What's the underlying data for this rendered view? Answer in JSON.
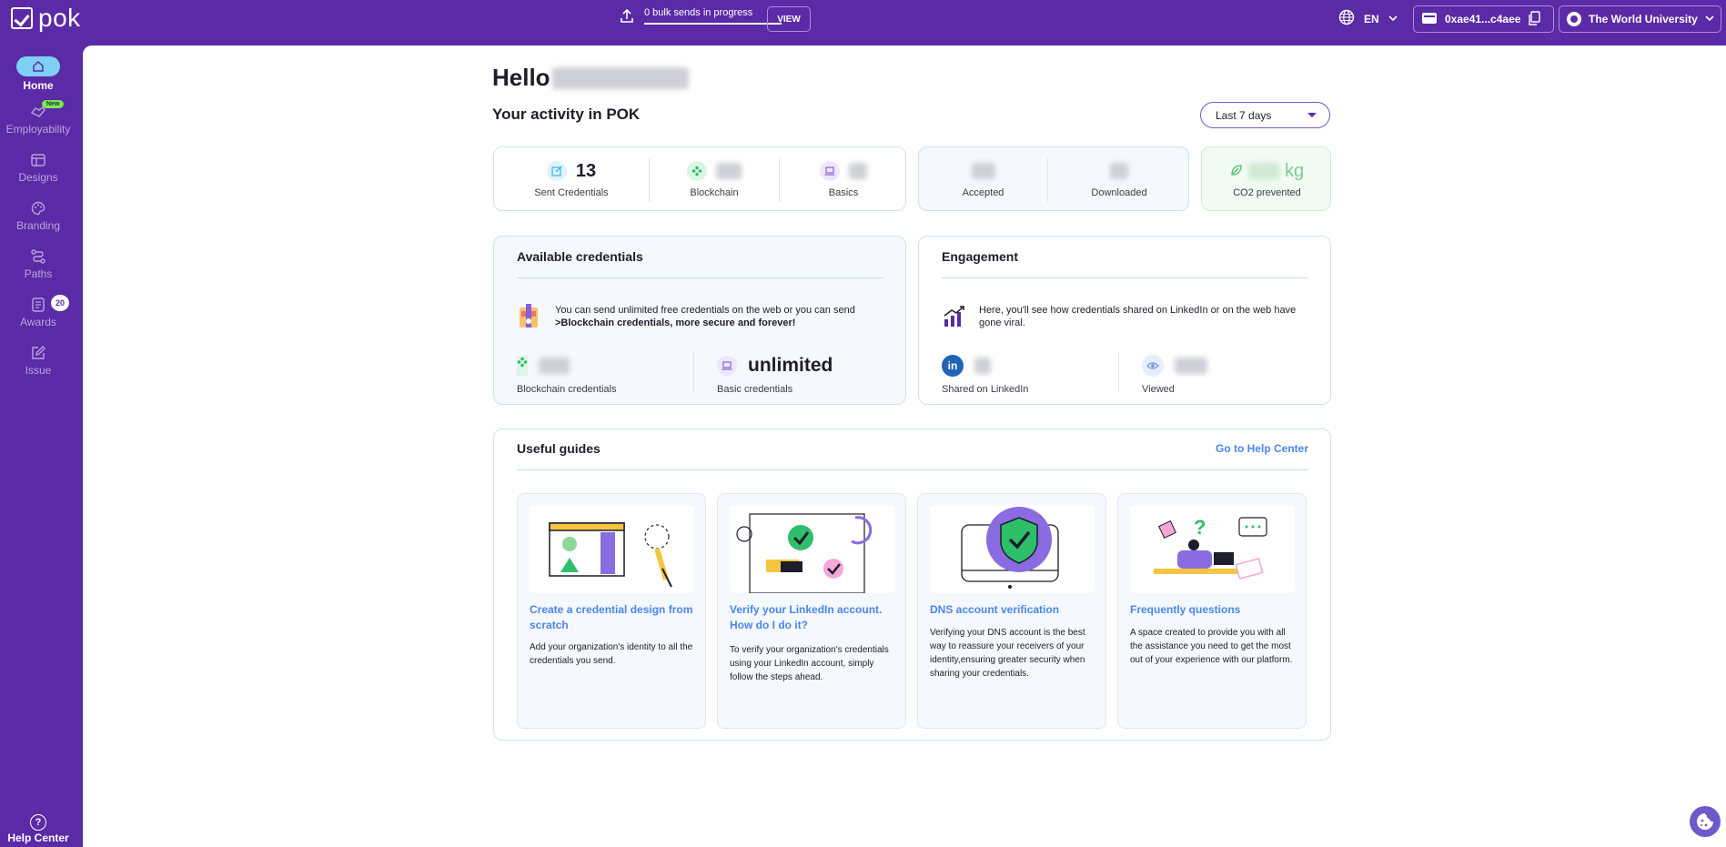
{
  "brand": {
    "name": "pok",
    "accent": "#5b2aa6"
  },
  "topbar": {
    "bulk_text": "0 bulk sends in progress",
    "view_label": "VIEW",
    "language": "EN",
    "wallet": "0xae41...c4aee",
    "organization": "The World University"
  },
  "sidebar": {
    "items": [
      {
        "label": "Home",
        "icon": "home-icon",
        "active": true
      },
      {
        "label": "Employability",
        "icon": "handshake-icon",
        "badge": "New"
      },
      {
        "label": "Designs",
        "icon": "layout-icon"
      },
      {
        "label": "Branding",
        "icon": "palette-icon"
      },
      {
        "label": "Paths",
        "icon": "route-icon"
      },
      {
        "label": "Awards",
        "icon": "document-icon",
        "badge": "20"
      },
      {
        "label": "Issue",
        "icon": "edit-icon"
      }
    ],
    "help_label": "Help Center"
  },
  "main": {
    "greeting": "Hello",
    "activity_title": "Your activity in POK",
    "range": "Last 7 days",
    "stats": {
      "sent_value": "13",
      "sent_label": "Sent Credentials",
      "blockchain_label": "Blockchain",
      "basics_label": "Basics",
      "accepted_label": "Accepted",
      "downloaded_label": "Downloaded",
      "co2_unit": "kg",
      "co2_label": "CO2 prevented"
    },
    "available": {
      "title": "Available credentials",
      "message_1": "You can send unlimited free credentials on the web or you can send",
      "message_2": ">Blockchain credentials, more secure and forever!",
      "blockchain_label": "Blockchain credentials",
      "basic_value": "unlimited",
      "basic_label": "Basic credentials"
    },
    "engagement": {
      "title": "Engagement",
      "message": "Here, you'll see how credentials shared on LinkedIn or on the web have gone viral.",
      "linkedin_label": "Shared on LinkedIn",
      "viewed_label": "Viewed"
    },
    "guides": {
      "title": "Useful guides",
      "help_link": "Go to Help Center",
      "items": [
        {
          "title": "Create a credential design from scratch",
          "desc": "Add your organization's identity to all the credentials you send."
        },
        {
          "title": "Verify your LinkedIn account. How do I do it?",
          "desc": "To verify your organization's credentials using your LinkedIn account, simply follow the steps ahead."
        },
        {
          "title": "DNS account verification",
          "desc": "Verifying your DNS account is the best way to reassure your receivers of your identity,ensuring greater security when sharing your credentials."
        },
        {
          "title": "Frequently questions",
          "desc": "A space created to provide you with all the assistance you need to get the most out of your experience with our platform."
        }
      ]
    }
  }
}
